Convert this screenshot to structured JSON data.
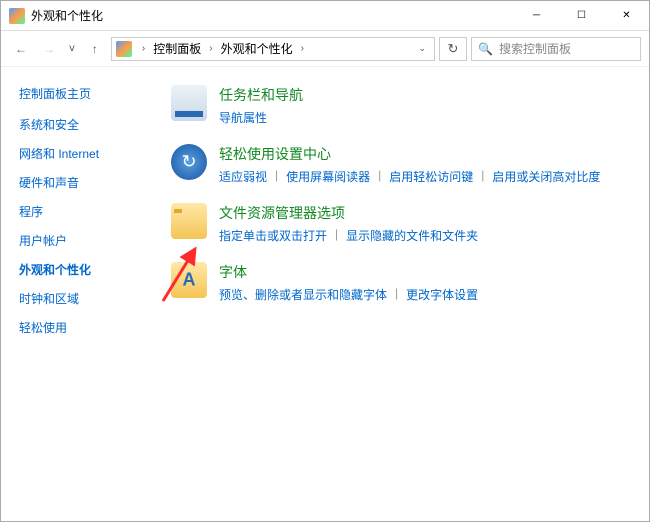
{
  "window": {
    "title": "外观和个性化"
  },
  "addressbar": {
    "root": "控制面板",
    "current": "外观和个性化"
  },
  "search": {
    "placeholder": "搜索控制面板"
  },
  "sidebar": {
    "home": "控制面板主页",
    "items": [
      {
        "label": "系统和安全",
        "active": false
      },
      {
        "label": "网络和 Internet",
        "active": false
      },
      {
        "label": "硬件和声音",
        "active": false
      },
      {
        "label": "程序",
        "active": false
      },
      {
        "label": "用户帐户",
        "active": false
      },
      {
        "label": "外观和个性化",
        "active": true
      },
      {
        "label": "时钟和区域",
        "active": false
      },
      {
        "label": "轻松使用",
        "active": false
      }
    ]
  },
  "categories": [
    {
      "title": "任务栏和导航",
      "icon": "taskbar-icon",
      "links": [
        "导航属性"
      ]
    },
    {
      "title": "轻松使用设置中心",
      "icon": "ease-of-access-icon",
      "links": [
        "适应弱视",
        "使用屏幕阅读器",
        "启用轻松访问键",
        "启用或关闭高对比度"
      ]
    },
    {
      "title": "文件资源管理器选项",
      "icon": "file-explorer-icon",
      "links": [
        "指定单击或双击打开",
        "显示隐藏的文件和文件夹"
      ]
    },
    {
      "title": "字体",
      "icon": "fonts-icon",
      "links": [
        "预览、删除或者显示和隐藏字体",
        "更改字体设置"
      ]
    }
  ]
}
